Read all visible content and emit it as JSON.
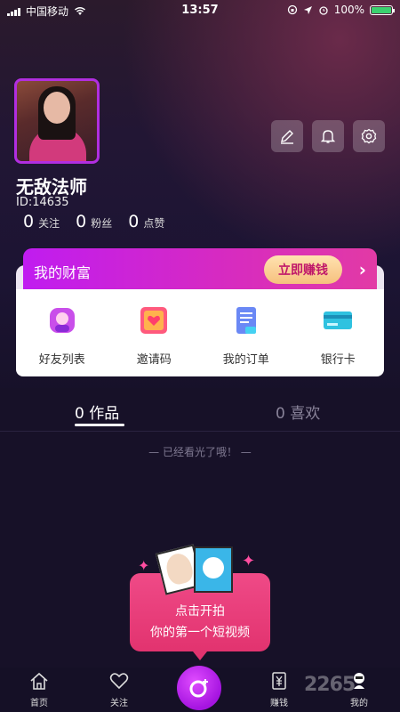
{
  "status_bar": {
    "carrier": "中国移动",
    "time": "13:57",
    "battery": "100%"
  },
  "profile": {
    "nickname": "无敌法师",
    "user_id": "ID:14635",
    "stats": [
      {
        "count": "0",
        "label": "关注"
      },
      {
        "count": "0",
        "label": "粉丝"
      },
      {
        "count": "0",
        "label": "点赞"
      }
    ]
  },
  "wealth": {
    "title": "我的财富",
    "earn_button": "立即赚钱",
    "chevron": "›"
  },
  "quick_actions": [
    {
      "label": "好友列表",
      "icon": "friends-icon",
      "color": "#b340e6"
    },
    {
      "label": "邀请码",
      "icon": "invite-icon",
      "color": "#ff5a7d"
    },
    {
      "label": "我的订单",
      "icon": "orders-icon",
      "color": "#5b7cf0"
    },
    {
      "label": "银行卡",
      "icon": "bankcard-icon",
      "color": "#2fc2e0"
    }
  ],
  "tabs": {
    "works": "0 作品",
    "likes": "0 喜欢"
  },
  "end_note": "— 已经看光了哦！ —",
  "shoot_prompt": {
    "line1": "点击开拍",
    "line2": "你的第一个短视频"
  },
  "bottom_nav": {
    "home": "首页",
    "follow": "关注",
    "earn": "赚钱",
    "mine": "我的"
  },
  "watermark": "2265",
  "colors": {
    "accent": "#b12ee0",
    "earn_text": "#c0186a",
    "prompt": "#e2336f"
  }
}
